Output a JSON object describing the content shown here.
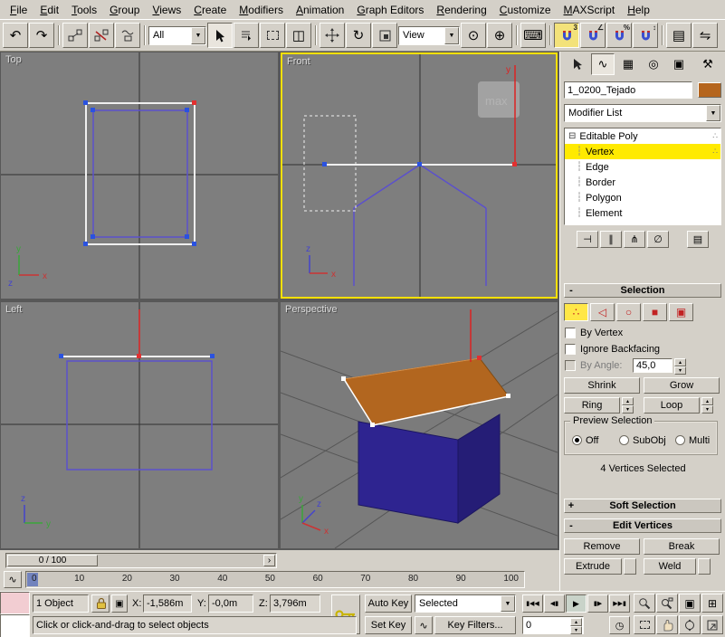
{
  "menu_bar": {
    "items": [
      "File",
      "Edit",
      "Tools",
      "Group",
      "Views",
      "Create",
      "Modifiers",
      "Animation",
      "Graph Editors",
      "Rendering",
      "Customize",
      "MAXScript",
      "Help"
    ]
  },
  "toolbar": {
    "selection_filter_value": "All",
    "coord_system_value": "View"
  },
  "icons": {
    "undo": "↶",
    "redo": "↷",
    "rotate": "↻",
    "window_crossing": "◫",
    "use_center": "⊙",
    "manipulate": "⊕",
    "keyboard_override": "⌨",
    "named_sets": "▤",
    "mirror": "⇋",
    "snap_3": "3",
    "snap_angle": "∠",
    "snap_percent": "%",
    "snap_spinner": "↕",
    "dropdown_arrow": "▼",
    "spinner_up": "▴",
    "spinner_down": "▾",
    "slider_arrow": "›",
    "curve": "∿",
    "minus": "-",
    "plus": "+",
    "stack_collapse": "⊟",
    "tree_line": "┆",
    "stack_dots": "∴",
    "pin_stack": "⊣",
    "show_end_result": "∥",
    "make_unique": "⋔",
    "remove_modifier": "∅",
    "configure_sets": "▤",
    "subobj_vertex": "∴",
    "subobj_edge": "◁",
    "subobj_border": "○",
    "subobj_polygon": "■",
    "subobj_element": "▣",
    "tab_modify": "∿",
    "tab_hierarchy": "▦",
    "tab_motion": "◎",
    "tab_display": "▣",
    "tab_utilities": "⚒",
    "transport_start": "▮◀◀",
    "transport_prev": "◀▮",
    "transport_play": "▶",
    "transport_next": "▮▶",
    "transport_end": "▶▶▮",
    "time_config": "◷",
    "zoom_extents": "▣",
    "zoom_extents_all": "⊞",
    "abs_offset": "▣"
  },
  "viewports": {
    "top_label": "Top",
    "front_label": "Front",
    "left_label": "Left",
    "perspective_label": "Perspective",
    "logo_text": "max",
    "axis": {
      "x": "x",
      "y": "y",
      "z": "z"
    }
  },
  "command_panel": {
    "object_name": "1_0200_Tejado",
    "modifier_list_label": "Modifier List",
    "stack_root": "Editable Poly",
    "stack_items": [
      "Vertex",
      "Edge",
      "Border",
      "Polygon",
      "Element"
    ],
    "selection": {
      "header": "Selection",
      "by_vertex_label": "By Vertex",
      "ignore_backfacing_label": "Ignore Backfacing",
      "by_angle_label": "By Angle:",
      "by_angle_value": "45,0",
      "shrink_label": "Shrink",
      "grow_label": "Grow",
      "ring_label": "Ring",
      "loop_label": "Loop",
      "preview_group_label": "Preview Selection",
      "preview_options": [
        "Off",
        "SubObj",
        "Multi"
      ],
      "status_text": "4 Vertices Selected"
    },
    "soft_selection_header": "Soft Selection",
    "edit_vertices": {
      "header": "Edit Vertices",
      "remove_label": "Remove",
      "break_label": "Break",
      "extrude_label": "Extrude",
      "weld_label": "Weld"
    }
  },
  "timeline": {
    "slider_value": "0 / 100",
    "ticks": [
      "0",
      "10",
      "20",
      "30",
      "40",
      "50",
      "60",
      "70",
      "80",
      "90",
      "100"
    ]
  },
  "status_bar": {
    "object_count": "1 Object",
    "x_label": "X:",
    "x_value": "-1,586m",
    "y_label": "Y:",
    "y_value": "-0,0m",
    "z_label": "Z:",
    "z_value": "3,796m",
    "prompt": "Click or click-and-drag to select objects",
    "auto_key_label": "Auto Key",
    "set_key_label": "Set Key",
    "key_filter_value": "Selected",
    "key_filters_label": "Key Filters...",
    "frame_value": "0"
  },
  "colors": {
    "object_color": "#b5651d",
    "active_viewport_border": "#ffe100",
    "selection_highlight": "#ffea00"
  }
}
